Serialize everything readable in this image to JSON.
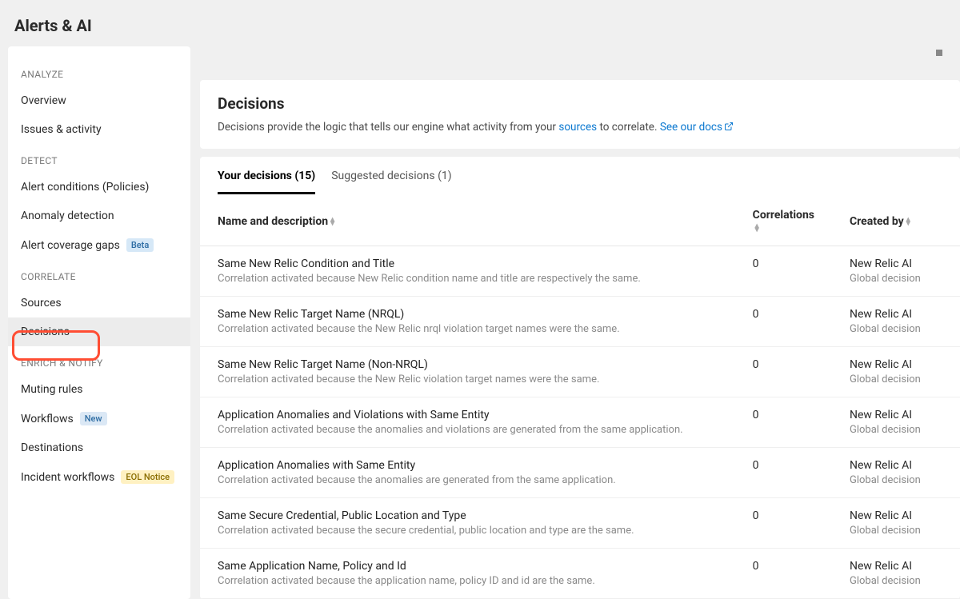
{
  "page_title": "Alerts & AI",
  "sidebar": {
    "sections": [
      {
        "header": "ANALYZE",
        "items": [
          {
            "label": "Overview"
          },
          {
            "label": "Issues & activity"
          }
        ]
      },
      {
        "header": "DETECT",
        "items": [
          {
            "label": "Alert conditions (Policies)"
          },
          {
            "label": "Anomaly detection"
          },
          {
            "label": "Alert coverage gaps",
            "badge": "Beta",
            "badge_class": "badge-beta"
          }
        ]
      },
      {
        "header": "CORRELATE",
        "items": [
          {
            "label": "Sources"
          },
          {
            "label": "Decisions",
            "active": true
          }
        ]
      },
      {
        "header": "ENRICH & NOTIFY",
        "items": [
          {
            "label": "Muting rules"
          },
          {
            "label": "Workflows",
            "badge": "New",
            "badge_class": "badge-new"
          },
          {
            "label": "Destinations"
          },
          {
            "label": "Incident workflows",
            "badge": "EOL Notice",
            "badge_class": "badge-eol"
          }
        ]
      }
    ]
  },
  "main": {
    "heading": "Decisions",
    "desc_pre": "Decisions provide the logic that tells our engine what activity from your ",
    "desc_link1": "sources",
    "desc_mid": " to correlate. ",
    "desc_link2": "See our docs",
    "tabs": [
      {
        "label": "Your decisions (15)",
        "active": true
      },
      {
        "label": "Suggested decisions (1)"
      }
    ],
    "columns": {
      "name": "Name and description",
      "correlations": "Correlations",
      "created": "Created by"
    },
    "rows": [
      {
        "name": "Same New Relic Condition and Title",
        "desc": "Correlation activated because New Relic condition name and title are respectively the same.",
        "correlations": "0",
        "created_by": "New Relic AI",
        "created_sub": "Global decision"
      },
      {
        "name": "Same New Relic Target Name (NRQL)",
        "desc": "Correlation activated because the New Relic nrql violation target names were the same.",
        "correlations": "0",
        "created_by": "New Relic AI",
        "created_sub": "Global decision"
      },
      {
        "name": "Same New Relic Target Name (Non-NRQL)",
        "desc": "Correlation activated because the New Relic violation target names were the same.",
        "correlations": "0",
        "created_by": "New Relic AI",
        "created_sub": "Global decision"
      },
      {
        "name": "Application Anomalies and Violations with Same Entity",
        "desc": "Correlation activated because the anomalies and violations are generated from the same application.",
        "correlations": "0",
        "created_by": "New Relic AI",
        "created_sub": "Global decision"
      },
      {
        "name": "Application Anomalies with Same Entity",
        "desc": "Correlation activated because the anomalies are generated from the same application.",
        "correlations": "0",
        "created_by": "New Relic AI",
        "created_sub": "Global decision"
      },
      {
        "name": "Same Secure Credential, Public Location and Type",
        "desc": "Correlation activated because the secure credential, public location and type are the same.",
        "correlations": "0",
        "created_by": "New Relic AI",
        "created_sub": "Global decision"
      },
      {
        "name": "Same Application Name, Policy and Id",
        "desc": "Correlation activated because the application name, policy ID and id are the same.",
        "correlations": "0",
        "created_by": "New Relic AI",
        "created_sub": "Global decision"
      }
    ]
  }
}
